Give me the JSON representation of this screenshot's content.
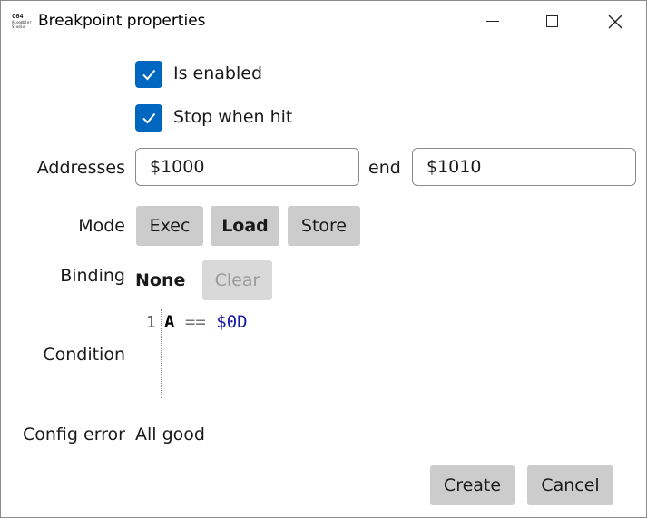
{
  "window": {
    "title": "Breakpoint properties",
    "app_icon_line1": "C64",
    "app_icon_line2": "Assembler",
    "app_icon_line3": "Studio"
  },
  "checkboxes": {
    "is_enabled": {
      "label": "Is enabled",
      "checked": true
    },
    "stop_when_hit": {
      "label": "Stop when hit",
      "checked": true
    }
  },
  "addresses": {
    "label": "Addresses",
    "start": "$1000",
    "end_label": "end",
    "end": "$1010"
  },
  "mode": {
    "label": "Mode",
    "options": [
      "Exec",
      "Load",
      "Store"
    ],
    "selected": "Load"
  },
  "binding": {
    "label": "Binding",
    "value": "None",
    "clear_label": "Clear"
  },
  "condition": {
    "label": "Condition",
    "line_number": "1",
    "register": "A",
    "operator": "==",
    "value": "$0D"
  },
  "config_error": {
    "label": "Config error",
    "value": "All good"
  },
  "footer": {
    "create_label": "Create",
    "cancel_label": "Cancel"
  },
  "colors": {
    "accent": "#0067c0",
    "button": "#cccccc",
    "number_token": "#1a1aa6"
  }
}
